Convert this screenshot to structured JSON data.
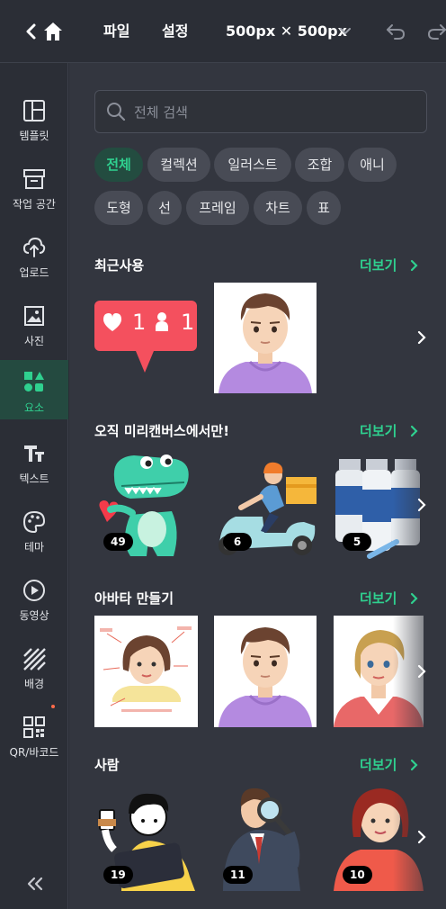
{
  "topbar": {
    "menu_file": "파일",
    "menu_settings": "설정",
    "canvas_size": "500px ✕ 500px"
  },
  "sidenav": {
    "items": [
      {
        "label": "템플릿",
        "icon": "template-icon"
      },
      {
        "label": "작업 공간",
        "icon": "workspace-icon"
      },
      {
        "label": "업로드",
        "icon": "upload-icon"
      },
      {
        "label": "사진",
        "icon": "photo-icon"
      },
      {
        "label": "요소",
        "icon": "elements-icon",
        "active": true
      },
      {
        "label": "텍스트",
        "icon": "text-icon"
      },
      {
        "label": "테마",
        "icon": "theme-palette-icon"
      },
      {
        "label": "동영상",
        "icon": "video-icon"
      },
      {
        "label": "배경",
        "icon": "background-icon"
      },
      {
        "label": "QR/바코드",
        "icon": "qr-code-icon"
      }
    ]
  },
  "search": {
    "placeholder": "전체 검색"
  },
  "chips": [
    "전체",
    "컬렉션",
    "일러스트",
    "조합",
    "애니",
    "도형",
    "선",
    "프레임",
    "차트",
    "표"
  ],
  "sections": {
    "recent": {
      "title": "최근사용",
      "more": "더보기",
      "like_count": "1",
      "follower_count": "1"
    },
    "exclusive": {
      "title": "오직 미리캔버스에서만!",
      "more": "더보기",
      "counts": [
        "49",
        "6",
        "5"
      ]
    },
    "avatar": {
      "title": "아바타 만들기",
      "more": "더보기"
    },
    "people": {
      "title": "사람",
      "more": "더보기",
      "counts": [
        "19",
        "11",
        "10"
      ]
    }
  },
  "colors": {
    "accent": "#2fd08f",
    "panel_bg": "#33363f",
    "nav_bg": "#2b2e36",
    "chip_bg": "#484b55"
  }
}
